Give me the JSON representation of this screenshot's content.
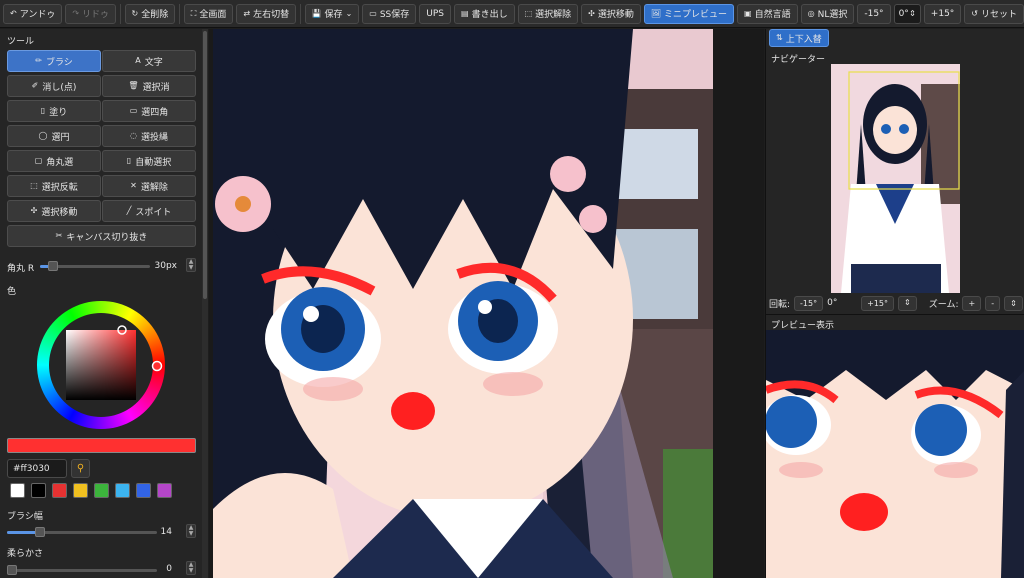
{
  "toolbar": {
    "undo": "アンドゥ",
    "redo": "リドゥ",
    "clear_all": "全削除",
    "fullscreen": "全画面",
    "flip_lr": "左右切替",
    "save": "保存",
    "ss_save": "SS保存",
    "ups": "UPS",
    "export": "書き出し",
    "deselect": "選択解除",
    "move_selection": "選択移動",
    "mini_preview": "ミニプレビュー",
    "natural_language": "自然言語",
    "nl_select": "NL選択",
    "rotate_minus": "-15°",
    "rotate_value": "0°",
    "rotate_plus": "+15°",
    "reset": "リセット"
  },
  "tools": {
    "title": "ツール",
    "items": [
      {
        "label": "ブラシ",
        "icon": "✏"
      },
      {
        "label": "文字",
        "icon": "A"
      },
      {
        "label": "消し(点)",
        "icon": "✐"
      },
      {
        "label": "選択消",
        "icon": "🗑"
      },
      {
        "label": "塗り",
        "icon": "▯"
      },
      {
        "label": "選四角",
        "icon": "▭"
      },
      {
        "label": "選円",
        "icon": "◯"
      },
      {
        "label": "選投縄",
        "icon": "◌"
      },
      {
        "label": "角丸選",
        "icon": "▢"
      },
      {
        "label": "自動選択",
        "icon": "▯"
      },
      {
        "label": "選択反転",
        "icon": "⬚"
      },
      {
        "label": "選解除",
        "icon": "✕"
      },
      {
        "label": "選択移動",
        "icon": "✣"
      },
      {
        "label": "スポイト",
        "icon": "╱"
      }
    ],
    "canvas_crop": "キャンバス切り抜き"
  },
  "corner_radius": {
    "label": "角丸 R",
    "value": "30px",
    "fraction": 0.12
  },
  "color": {
    "title": "色",
    "hex": "#ff3030",
    "current": "#ff3030",
    "swatches": [
      "#ffffff",
      "#000000",
      "#e63232",
      "#f0c020",
      "#3cb43c",
      "#3cb4f0",
      "#3264e6",
      "#b446c8"
    ]
  },
  "brush_size": {
    "label": "ブラシ幅",
    "value": "14",
    "fraction": 0.22
  },
  "softness": {
    "label": "柔らかさ",
    "value": "0",
    "fraction": 0.0
  },
  "navigator": {
    "flip_ud": "上下入替",
    "title": "ナビゲーター",
    "rotate_label": "回転:",
    "rotate_minus": "-15°",
    "rotate_value": "0°",
    "rotate_plus": "+15°",
    "zoom_label": "ズーム:",
    "zoom_plus": "+",
    "zoom_minus": "-",
    "zoom_fit": "⇕"
  },
  "preview": {
    "title": "プレビュー表示"
  }
}
